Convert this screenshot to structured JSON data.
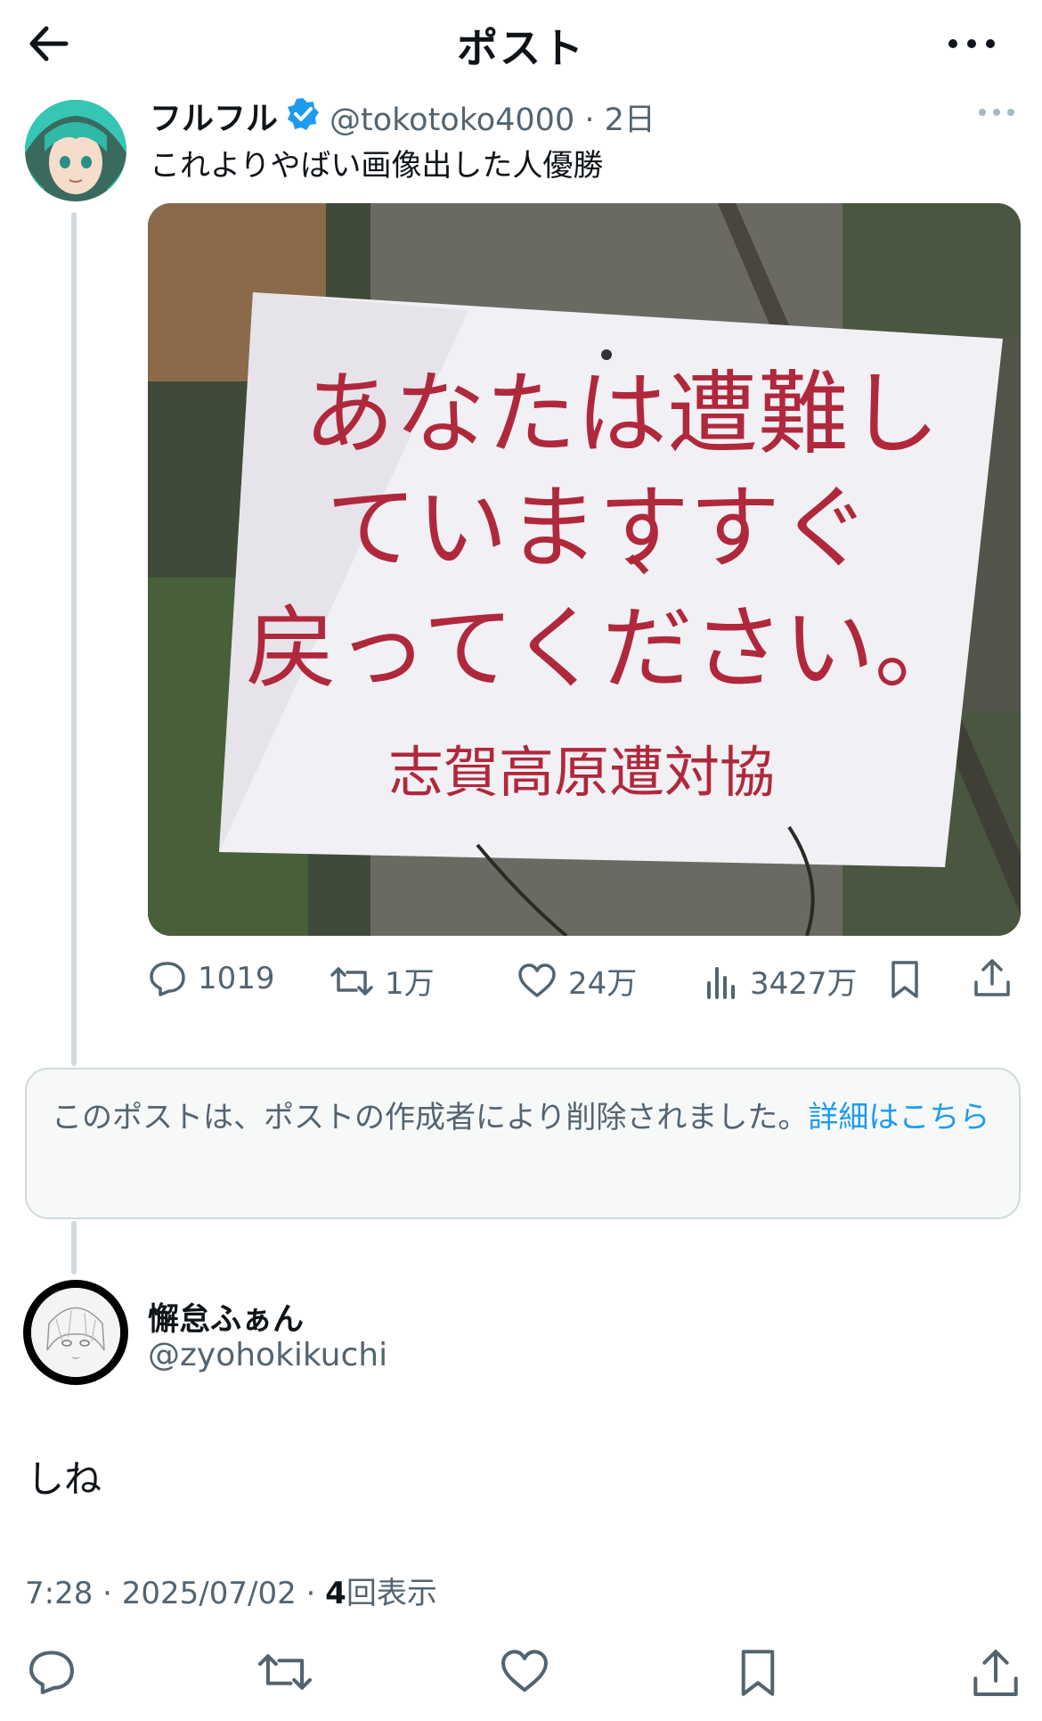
{
  "header": {
    "title": "ポスト",
    "back_icon": "arrow-left-icon",
    "more_icon": "more-horizontal-icon"
  },
  "quoted_post": {
    "author_name": "フルフル",
    "author_handle": "@tokotoko4000 · 2日",
    "text": "これよりやばい画像出した人優勝",
    "image_sign": {
      "line1": "あなたは遭難し",
      "line2": "ていますすぐ",
      "line2_comma": "、",
      "line3": "戻ってください。",
      "signature": "志賀高原遭対協"
    },
    "actions": {
      "replies": "1019",
      "retweets": "1万",
      "likes": "24万",
      "views": "3427万"
    }
  },
  "deleted_notice": {
    "text": "このポストは、ポストの作成者により削除されました。",
    "link": "詳細はこちら"
  },
  "main_post": {
    "author_name": "懈怠ふぁん",
    "author_handle": "@zyohokikuchi",
    "text": "しね",
    "time": "7:28 · 2025/07/02 · ",
    "view_count": "4",
    "view_label": "回表示"
  },
  "colors": {
    "accent": "#1d9bf0",
    "muted": "#536471",
    "border": "#cfd9de",
    "sign_text": "#b0283c"
  }
}
